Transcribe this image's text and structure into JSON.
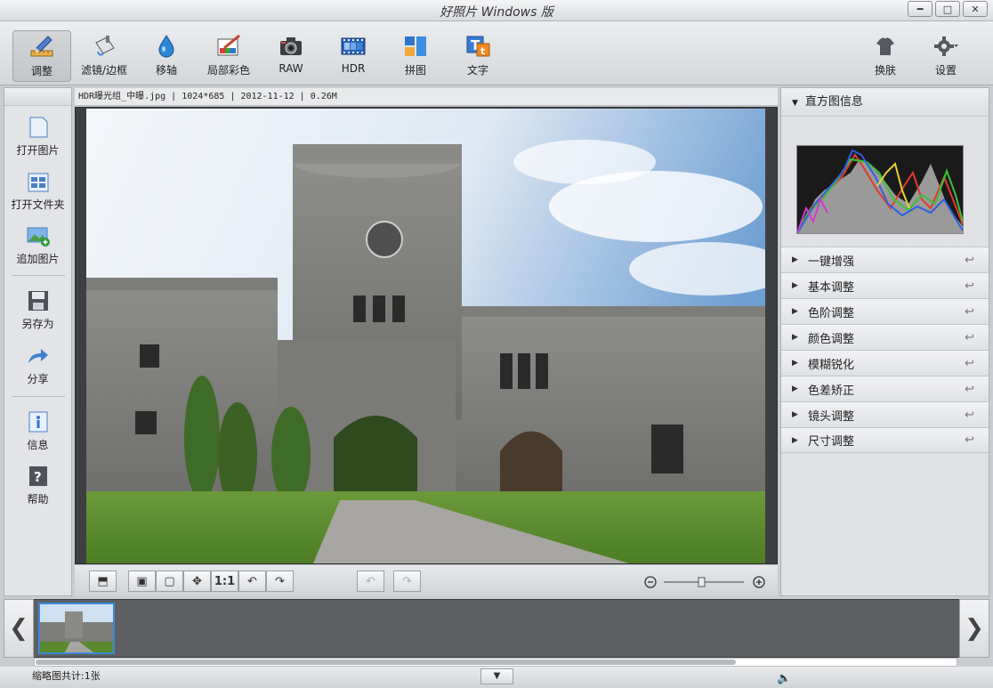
{
  "window": {
    "title": "好照片 Windows 版"
  },
  "toolbar": {
    "tools": [
      {
        "label": "调整"
      },
      {
        "label": "滤镜/边框"
      },
      {
        "label": "移轴"
      },
      {
        "label": "局部彩色"
      },
      {
        "label": "RAW"
      },
      {
        "label": "HDR"
      },
      {
        "label": "拼图"
      },
      {
        "label": "文字"
      }
    ],
    "skin_label": "换肤",
    "settings_label": "设置"
  },
  "left_panel": {
    "items": [
      {
        "label": "打开图片"
      },
      {
        "label": "打开文件夹"
      },
      {
        "label": "追加图片"
      },
      {
        "label": "另存为"
      },
      {
        "label": "分享"
      },
      {
        "label": "信息"
      },
      {
        "label": "帮助"
      }
    ]
  },
  "image_info": "HDR曝光组_中曝.jpg | 1024*685 | 2012-11-12 | 0.26M",
  "view_tools": {
    "one_to_one": "1:1"
  },
  "right_panel": {
    "histogram_title": "直方图信息",
    "sections": [
      {
        "label": "一键增强"
      },
      {
        "label": "基本调整"
      },
      {
        "label": "色阶调整"
      },
      {
        "label": "颜色调整"
      },
      {
        "label": "模糊锐化"
      },
      {
        "label": "色差矫正"
      },
      {
        "label": "镜头调整"
      },
      {
        "label": "尺寸调整"
      }
    ]
  },
  "status": {
    "thumb_count": "缩略图共计:1张"
  },
  "colors": {
    "accent": "#3a8ad6",
    "panel": "#dfe1e4",
    "viewer_bg": "#3d3f42"
  }
}
